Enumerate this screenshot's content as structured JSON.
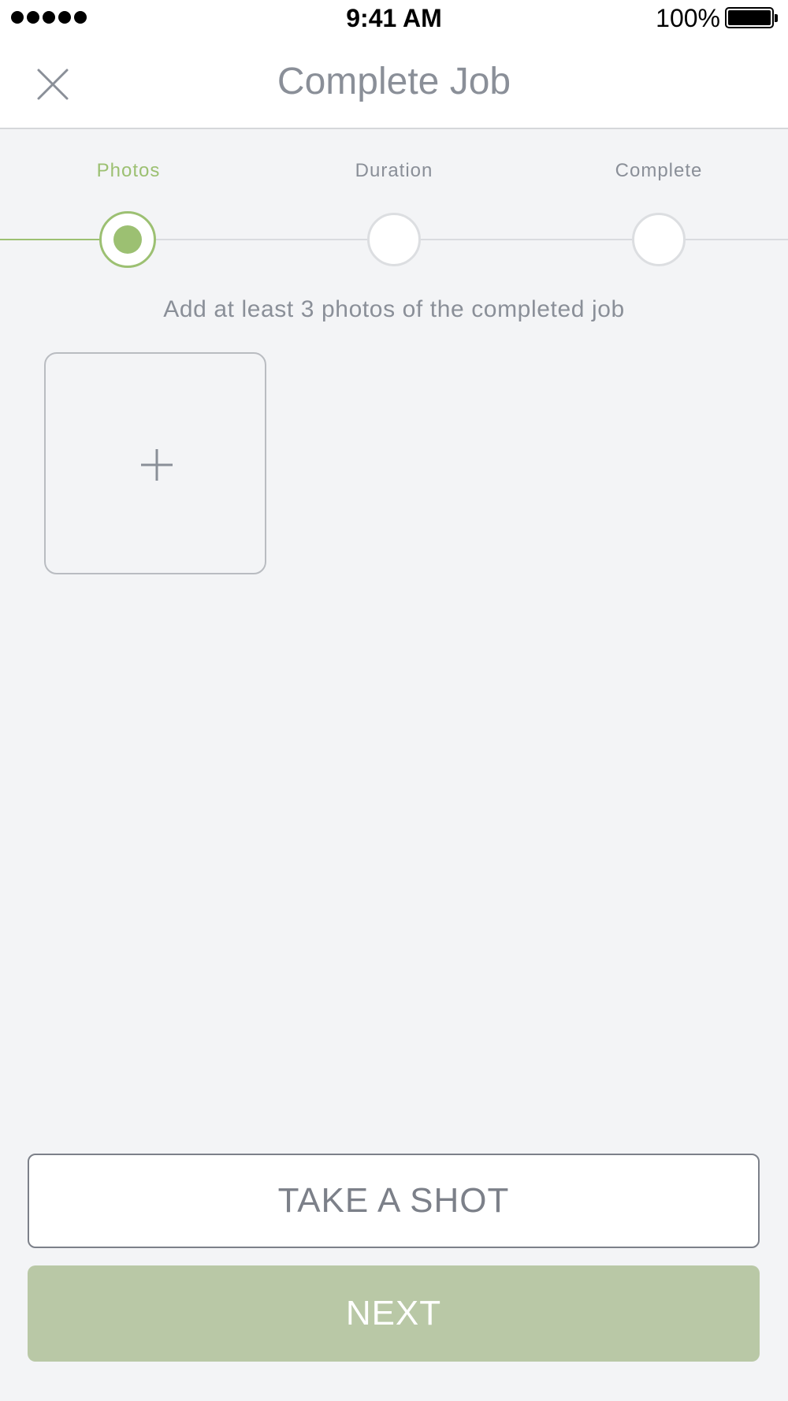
{
  "status_bar": {
    "time": "9:41 AM",
    "battery": "100%",
    "signal_icon": "signal-dots-icon",
    "battery_icon": "battery-icon"
  },
  "nav": {
    "title": "Complete Job",
    "close_icon": "close-icon"
  },
  "stepper": {
    "steps": [
      {
        "label": "Photos",
        "state": "active"
      },
      {
        "label": "Duration",
        "state": "pending"
      },
      {
        "label": "Complete",
        "state": "pending"
      }
    ],
    "active_color": "#9cc072"
  },
  "content": {
    "instruction": "Add at least 3 photos of the completed job",
    "add_photo_icon": "plus-icon"
  },
  "actions": {
    "take_shot_label": "TAKE A SHOT",
    "next_label": "NEXT",
    "next_color": "#b9c8a6"
  }
}
